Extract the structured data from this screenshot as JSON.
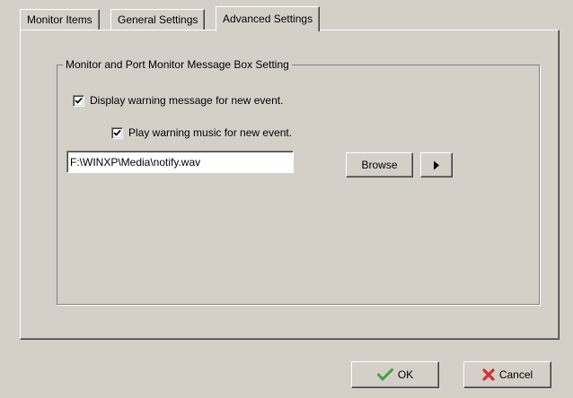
{
  "tabs": [
    {
      "label": "Monitor Items",
      "active": false
    },
    {
      "label": "General Settings",
      "active": false
    },
    {
      "label": "Advanced Settings",
      "active": true
    }
  ],
  "group": {
    "title": "Monitor and Port Monitor Message Box Setting",
    "display_warning": {
      "label": "Display warning message for new event.",
      "checked": true
    },
    "play_music": {
      "label": "Play warning music for new event.",
      "checked": true
    },
    "file_path": {
      "value": "F:\\WINXP\\Media\\notify.wav"
    },
    "browse_label": "Browse",
    "play_icon": "play-triangle-icon"
  },
  "footer": {
    "ok_label": "OK",
    "ok_icon": "checkmark-icon",
    "cancel_label": "Cancel",
    "cancel_icon": "x-icon"
  },
  "colors": {
    "background": "#d4d0c8",
    "ok_green": "#3da33d",
    "cancel_red": "#d03030"
  }
}
